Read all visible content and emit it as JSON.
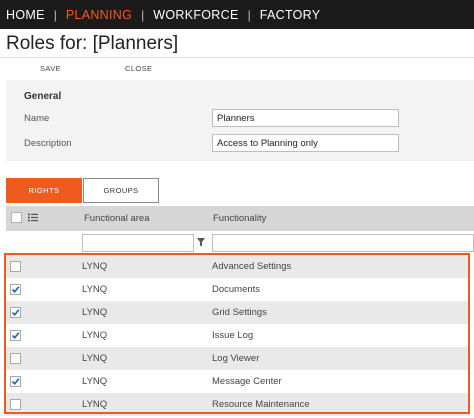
{
  "nav": {
    "items": [
      {
        "label": "HOME",
        "active": false
      },
      {
        "label": "PLANNING",
        "active": true
      },
      {
        "label": "WORKFORCE",
        "active": false
      },
      {
        "label": "FACTORY",
        "active": false
      }
    ],
    "separator": "|"
  },
  "title": "Roles for: [Planners]",
  "toolbar": {
    "save_label": "SAVE",
    "close_label": "CLOSE"
  },
  "general": {
    "heading": "General",
    "name_label": "Name",
    "name_value": "Planners",
    "description_label": "Description",
    "description_value": "Access to Planning only"
  },
  "tabs": {
    "rights": "RIGHTS",
    "groups": "GROUPS"
  },
  "grid": {
    "columns": {
      "functional_area": "Functional area",
      "functionality": "Functionality"
    },
    "filters": {
      "functional_area": "",
      "functionality": ""
    },
    "rows": [
      {
        "area": "LYNQ",
        "functionality": "Advanced Settings",
        "checked": false
      },
      {
        "area": "LYNQ",
        "functionality": "Documents",
        "checked": true
      },
      {
        "area": "LYNQ",
        "functionality": "Grid Settings",
        "checked": true
      },
      {
        "area": "LYNQ",
        "functionality": "Issue Log",
        "checked": true
      },
      {
        "area": "LYNQ",
        "functionality": "Log Viewer",
        "checked": false
      },
      {
        "area": "LYNQ",
        "functionality": "Message Center",
        "checked": true
      },
      {
        "area": "LYNQ",
        "functionality": "Resource Maintenance",
        "checked": false
      }
    ]
  },
  "colors": {
    "accent": "#f05a1e",
    "nav_bg": "#1b1b1b",
    "check": "#1a5fb4"
  },
  "icons": {
    "list": "list-icon",
    "filter": "funnel-icon",
    "check": "checkmark-icon"
  }
}
